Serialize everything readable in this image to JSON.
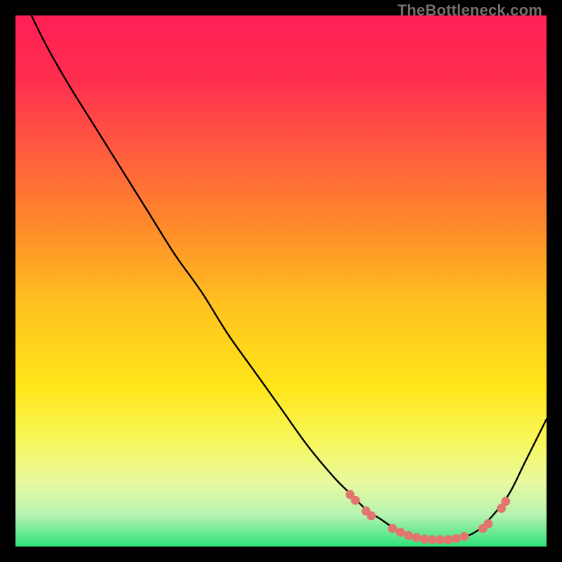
{
  "watermark": "TheBottleneck.com",
  "gradient": {
    "stops": [
      {
        "offset": 0.0,
        "color": "#ff1f55"
      },
      {
        "offset": 0.12,
        "color": "#ff2e4f"
      },
      {
        "offset": 0.25,
        "color": "#ff5a3f"
      },
      {
        "offset": 0.4,
        "color": "#ff8b2a"
      },
      {
        "offset": 0.55,
        "color": "#ffc41f"
      },
      {
        "offset": 0.7,
        "color": "#ffe61a"
      },
      {
        "offset": 0.8,
        "color": "#f7f75a"
      },
      {
        "offset": 0.88,
        "color": "#e8f9a0"
      },
      {
        "offset": 0.94,
        "color": "#b6f3b0"
      },
      {
        "offset": 1.0,
        "color": "#2fe37a"
      }
    ]
  },
  "chart_data": {
    "type": "line",
    "title": "",
    "xlabel": "",
    "ylabel": "",
    "xlim": [
      0,
      100
    ],
    "ylim": [
      0,
      100
    ],
    "note": "Axes are normalized percentages (0–100). Y is plotted with 0 at top, 100 at bottom (minimum of curve near bottom = best / green zone).",
    "series": [
      {
        "name": "bottleneck-curve",
        "x": [
          3,
          6,
          10,
          15,
          20,
          25,
          30,
          35,
          40,
          45,
          50,
          55,
          60,
          63,
          66,
          69,
          72,
          75,
          78,
          81,
          84,
          87,
          90,
          93,
          96,
          100
        ],
        "y": [
          0,
          6,
          13,
          21,
          29,
          37,
          45,
          52,
          60,
          67,
          74,
          81,
          87,
          90,
          93,
          95,
          97,
          98,
          98.7,
          98.7,
          98.3,
          97,
          94,
          90,
          84,
          76
        ]
      }
    ],
    "markers": {
      "name": "highlight-dots",
      "color": "#e2766e",
      "points": [
        {
          "x": 63,
          "y": 90.2
        },
        {
          "x": 64,
          "y": 91.3
        },
        {
          "x": 66,
          "y": 93.3
        },
        {
          "x": 67,
          "y": 94.2
        },
        {
          "x": 71,
          "y": 96.6
        },
        {
          "x": 72.5,
          "y": 97.3
        },
        {
          "x": 74,
          "y": 97.9
        },
        {
          "x": 75.5,
          "y": 98.3
        },
        {
          "x": 77,
          "y": 98.6
        },
        {
          "x": 78.5,
          "y": 98.7
        },
        {
          "x": 80,
          "y": 98.7
        },
        {
          "x": 81.5,
          "y": 98.7
        },
        {
          "x": 83,
          "y": 98.5
        },
        {
          "x": 84.5,
          "y": 98.1
        },
        {
          "x": 88,
          "y": 96.6
        },
        {
          "x": 89,
          "y": 95.7
        },
        {
          "x": 91.5,
          "y": 92.8
        },
        {
          "x": 92.3,
          "y": 91.5
        }
      ]
    }
  }
}
